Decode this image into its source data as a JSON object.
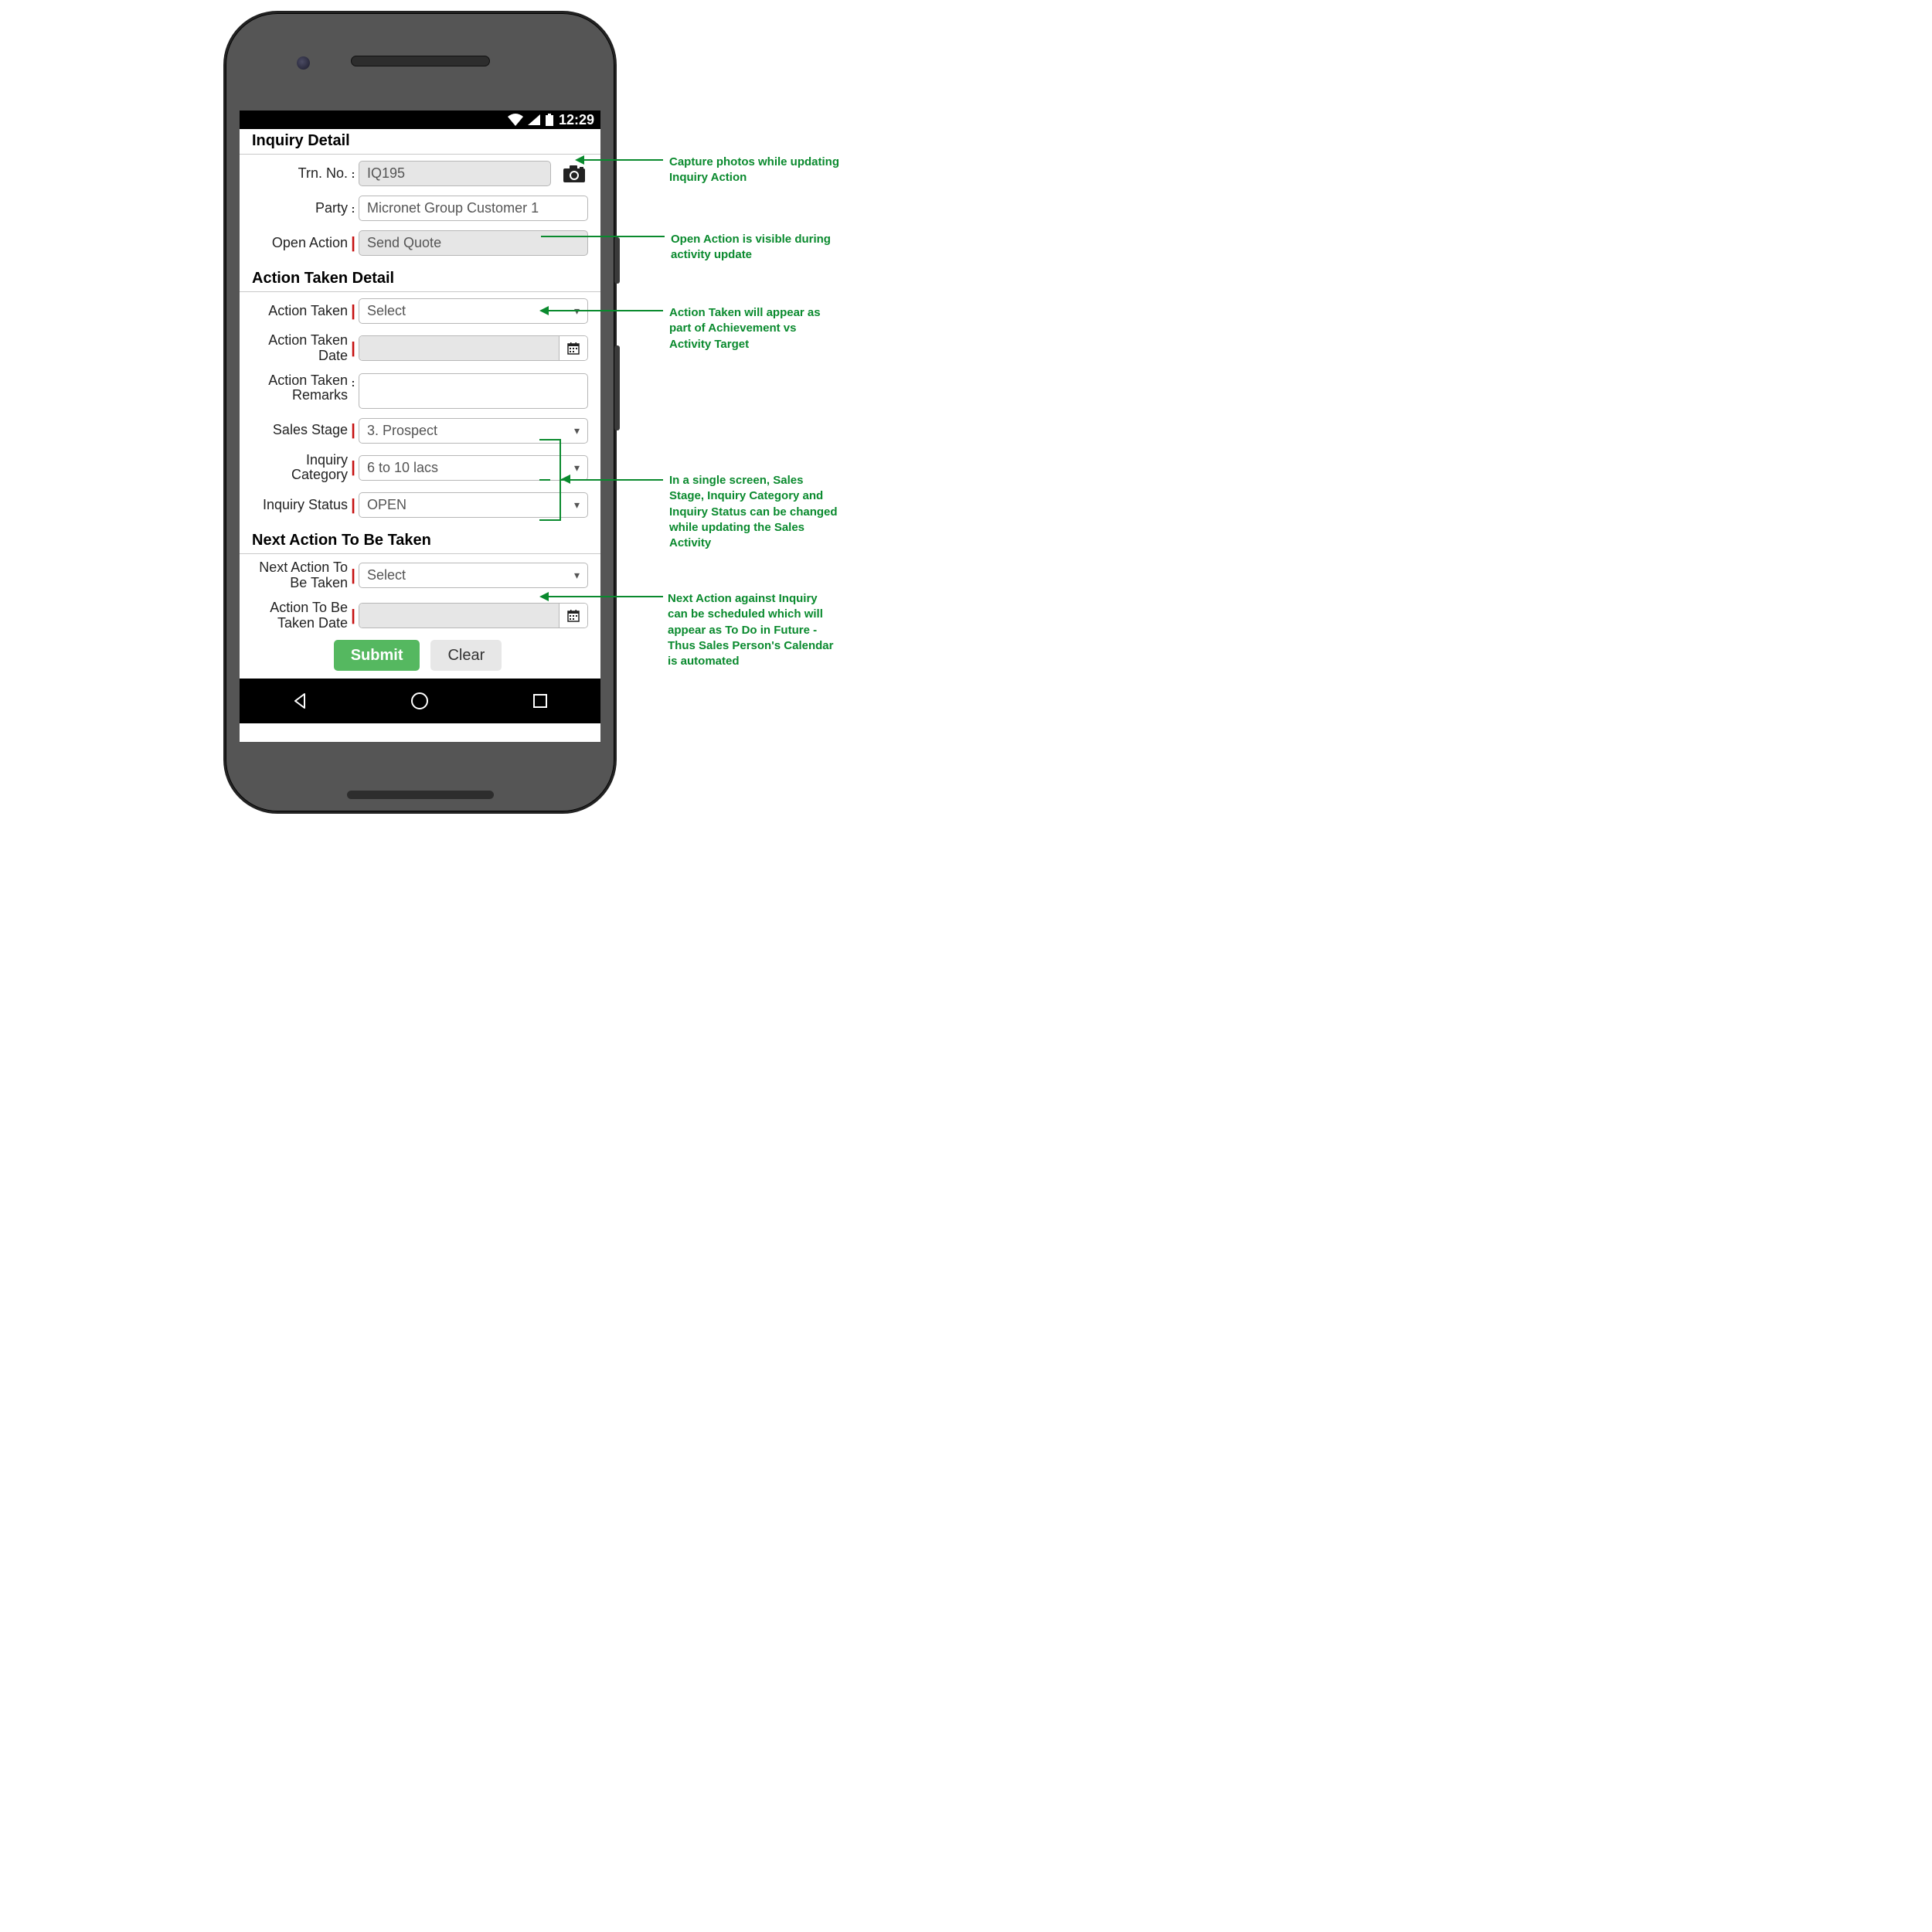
{
  "statusbar": {
    "time": "12:29"
  },
  "sections": {
    "inquiry_detail": "Inquiry Detail",
    "action_taken_detail": "Action Taken Detail",
    "next_action": "Next Action To Be Taken"
  },
  "labels": {
    "trn_no": "Trn. No.",
    "party": "Party",
    "open_action": "Open Action",
    "action_taken": "Action Taken",
    "action_taken_date": "Action Taken Date",
    "action_taken_remarks": "Action Taken Remarks",
    "sales_stage": "Sales Stage",
    "inquiry_category": "Inquiry Category",
    "inquiry_status": "Inquiry Status",
    "next_action_to_be_taken": "Next Action To Be Taken",
    "action_to_be_taken_date": "Action To Be Taken Date"
  },
  "values": {
    "trn_no": "IQ195",
    "party": "Micronet Group Customer 1",
    "open_action": "Send Quote",
    "action_taken": "Select",
    "action_taken_date": "",
    "action_taken_remarks": "",
    "sales_stage": "3. Prospect",
    "inquiry_category": "6 to 10 lacs",
    "inquiry_status": "OPEN",
    "next_action_to_be_taken": "Select",
    "action_to_be_taken_date": ""
  },
  "buttons": {
    "submit": "Submit",
    "clear": "Clear"
  },
  "callouts": {
    "camera": "Capture photos while updating Inquiry Action",
    "open_action": "Open Action is visible during activity update",
    "action_taken": "Action Taken will appear as part of Achievement vs Activity Target",
    "combined": "In a single screen, Sales Stage, Inquiry Category and Inquiry Status can be changed while updating the Sales Activity",
    "next_action": "Next Action against Inquiry can be scheduled which will appear as To Do in Future - Thus Sales Person's Calendar is automated"
  }
}
